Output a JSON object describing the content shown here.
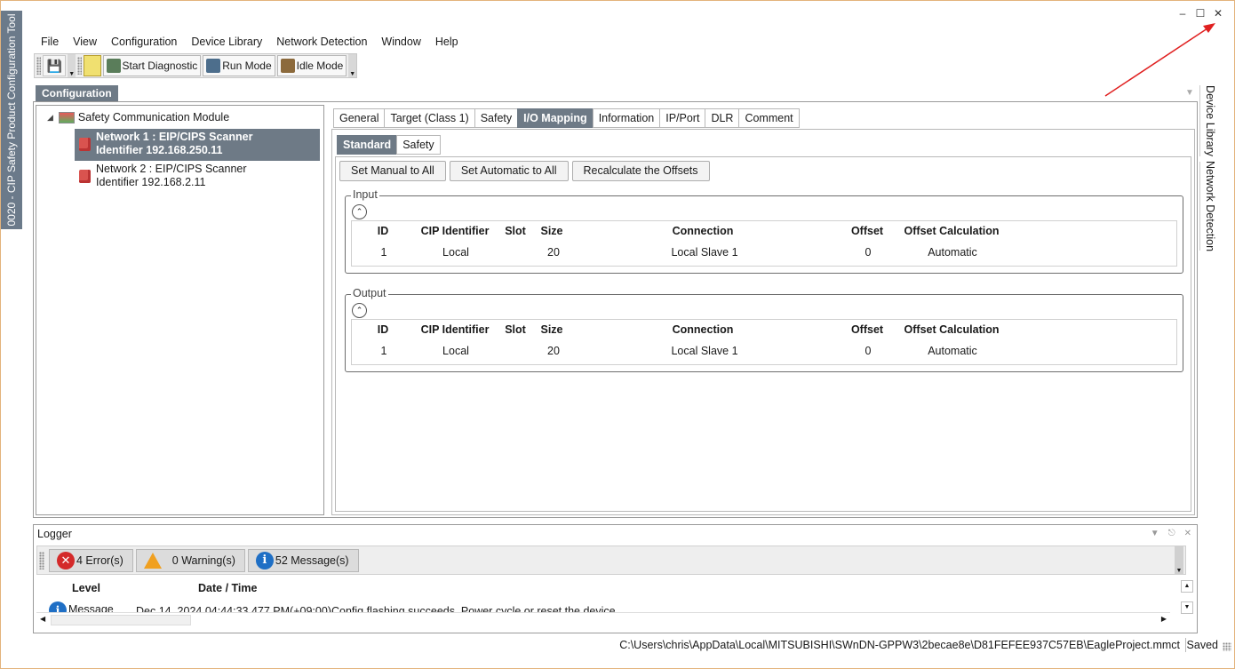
{
  "app": {
    "vertical_title": "0020 - CIP Safety Product Configuration Tool"
  },
  "window_controls": {
    "minimize": "–",
    "maximize": "☐",
    "close": "✕"
  },
  "menu": [
    "File",
    "View",
    "Configuration",
    "Device Library",
    "Network Detection",
    "Window",
    "Help"
  ],
  "toolbar": {
    "start_diagnostic": "Start Diagnostic",
    "run_mode": "Run Mode",
    "idle_mode": "Idle Mode"
  },
  "configuration_panel": {
    "title": "Configuration",
    "tree": {
      "root": "Safety Communication Module",
      "nodes": [
        {
          "line1": "Network 1 : EIP/CIPS Scanner",
          "line2": "Identifier 192.168.250.11",
          "selected": true
        },
        {
          "line1": "Network 2 : EIP/CIPS Scanner",
          "line2": "Identifier 192.168.2.11",
          "selected": false
        }
      ]
    }
  },
  "tabs": [
    "General",
    "Target (Class 1)",
    "Safety",
    "I/O Mapping",
    "Information",
    "IP/Port",
    "DLR",
    "Comment"
  ],
  "active_tab": "I/O Mapping",
  "subtabs": [
    "Standard",
    "Safety"
  ],
  "active_subtab": "Standard",
  "actions": {
    "set_manual": "Set Manual to All",
    "set_automatic": "Set Automatic to All",
    "recalculate": "Recalculate the Offsets"
  },
  "columns": [
    "ID",
    "CIP Identifier",
    "Slot",
    "Size",
    "Connection",
    "Offset",
    "Offset Calculation"
  ],
  "input": {
    "label": "Input",
    "rows": [
      {
        "id": "1",
        "cip_identifier": "Local",
        "slot": "",
        "size": "20",
        "connection": "Local Slave 1",
        "offset": "0",
        "offset_calc": "Automatic"
      }
    ]
  },
  "output": {
    "label": "Output",
    "rows": [
      {
        "id": "1",
        "cip_identifier": "Local",
        "slot": "",
        "size": "20",
        "connection": "Local Slave 1",
        "offset": "0",
        "offset_calc": "Automatic"
      }
    ]
  },
  "logger": {
    "title": "Logger",
    "errors": "4 Error(s)",
    "warnings": "0 Warning(s)",
    "messages": "52 Message(s)",
    "columns": {
      "level": "Level",
      "datetime": "Date / Time"
    },
    "rows": [
      {
        "level": "Message",
        "datetime": "Dec 14, 2024 04:44:33.477 PM(+09:00)",
        "message": "Config flashing succeeds. Power cycle or reset the device."
      }
    ]
  },
  "status": {
    "path": "C:\\Users\\chris\\AppData\\Local\\MITSUBISHI\\SWnDN-GPPW3\\2becae8e\\D81FEFEE937C57EB\\EagleProject.mmct",
    "state": "Saved"
  },
  "right_dock": [
    "Device Library",
    "Network Detection"
  ],
  "colors": {
    "accent": "#6e7a86",
    "annotation_arrow": "#e02020",
    "error": "#d42a2a",
    "warning": "#f0a020",
    "info": "#1f6fc5"
  }
}
